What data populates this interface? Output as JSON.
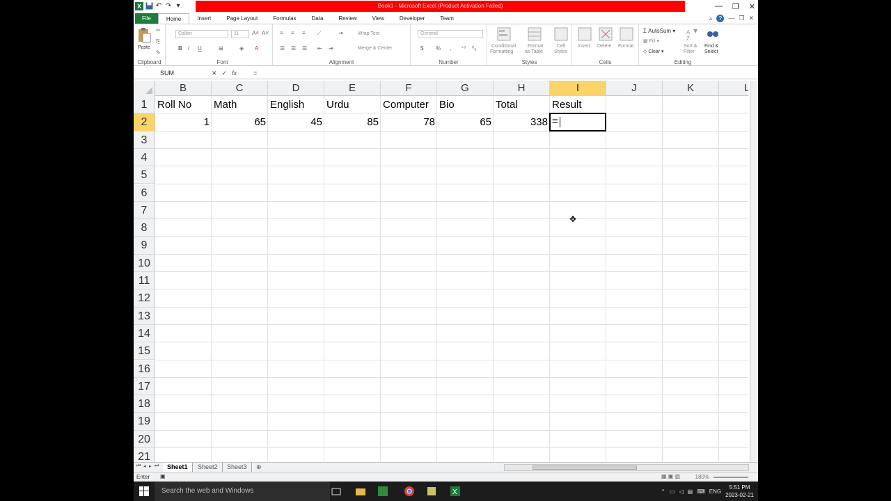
{
  "window": {
    "title": "Book1 - Microsoft Excel (Product Activation Failed)",
    "app_icon": "X",
    "controls": [
      "—",
      "❐",
      "✕"
    ]
  },
  "tabs": [
    {
      "label": "File",
      "kind": "file"
    },
    {
      "label": "Home",
      "kind": "active"
    },
    {
      "label": "Insert"
    },
    {
      "label": "Page Layout"
    },
    {
      "label": "Formulas"
    },
    {
      "label": "Data"
    },
    {
      "label": "Review"
    },
    {
      "label": "View"
    },
    {
      "label": "Developer"
    },
    {
      "label": "Team"
    }
  ],
  "ribbon": {
    "clipboard": {
      "label": "Clipboard",
      "paste": "Paste"
    },
    "font": {
      "label": "Font",
      "font_name": "Calibri",
      "font_size": "11"
    },
    "alignment": {
      "label": "Alignment",
      "wrap": "Wrap Text",
      "merge": "Merge & Center"
    },
    "number": {
      "label": "Number",
      "format": "General"
    },
    "styles": {
      "label": "Styles",
      "conditional": "Conditional",
      "conditional2": "Formatting",
      "format_table": "Format",
      "format_table2": "as Table",
      "cell_styles": "Cell",
      "cell_styles2": "Styles"
    },
    "cells": {
      "label": "Cells",
      "insert": "Insert",
      "delete": "Delete",
      "format": "Format"
    },
    "editing": {
      "label": "Editing",
      "autosum": "AutoSum",
      "fill": "Fill",
      "clear": "Clear",
      "sort": "Sort &",
      "sort2": "Filter",
      "find": "Find &",
      "find2": "Select"
    }
  },
  "formula_bar": {
    "name_box": "SUM",
    "content": "="
  },
  "grid": {
    "columns": [
      "B",
      "C",
      "D",
      "E",
      "F",
      "G",
      "H",
      "I",
      "J",
      "K",
      "L"
    ],
    "selected_column": "I",
    "rows": [
      "1",
      "2",
      "3",
      "4",
      "5",
      "6",
      "7",
      "8",
      "9",
      "10",
      "11",
      "12",
      "13",
      "14",
      "15",
      "16",
      "17",
      "18",
      "19",
      "20",
      "21"
    ],
    "selected_row": "2",
    "headers": [
      "Roll No",
      "Math",
      "English",
      "Urdu",
      "Computer",
      "Bio",
      "Total",
      "Result"
    ],
    "values": [
      "1",
      "65",
      "45",
      "85",
      "78",
      "65",
      "338"
    ],
    "active_cell_text": "="
  },
  "sheets": [
    {
      "label": "Sheet1",
      "active": true
    },
    {
      "label": "Sheet2"
    },
    {
      "label": "Sheet3"
    }
  ],
  "status": {
    "mode": "Enter",
    "zoom": "180%"
  },
  "taskbar": {
    "search_placeholder": "Search the web and Windows",
    "lang": "ENG",
    "time": "5:51 PM",
    "date": "2023-02-21"
  }
}
